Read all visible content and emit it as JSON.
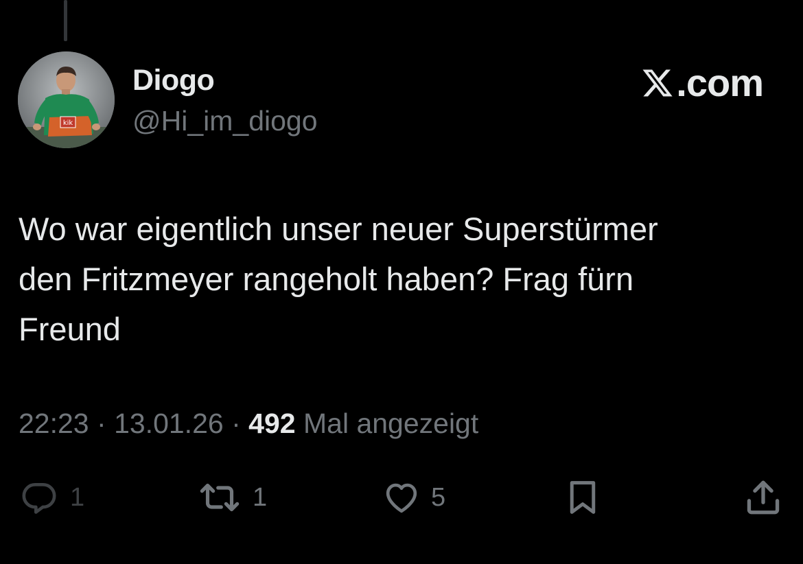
{
  "author": {
    "display_name": "Diogo",
    "handle": "@Hi_im_diogo",
    "avatar_jersey_text": "kik"
  },
  "brand": {
    "label": ".com",
    "logo_icon": "x-logo-icon"
  },
  "tweet": {
    "lines": [
      "Wo war eigentlich unser neuer Superstürmer",
      "den Fritzmeyer rangeholt haben? Frag fürn",
      "Freund"
    ]
  },
  "meta": {
    "time": "22:23",
    "separator": "·",
    "date": "13.01.26",
    "views_count": "492",
    "views_label": "Mal angezeigt"
  },
  "actions": {
    "reply": {
      "icon": "reply-icon",
      "count": "1"
    },
    "retweet": {
      "icon": "retweet-icon",
      "count": "1"
    },
    "like": {
      "icon": "heart-icon",
      "count": "5"
    },
    "bookmark": {
      "icon": "bookmark-icon"
    },
    "share": {
      "icon": "share-icon"
    }
  },
  "colors": {
    "background": "#000000",
    "primary_text": "#e7e9ea",
    "secondary_text": "#71767b"
  }
}
